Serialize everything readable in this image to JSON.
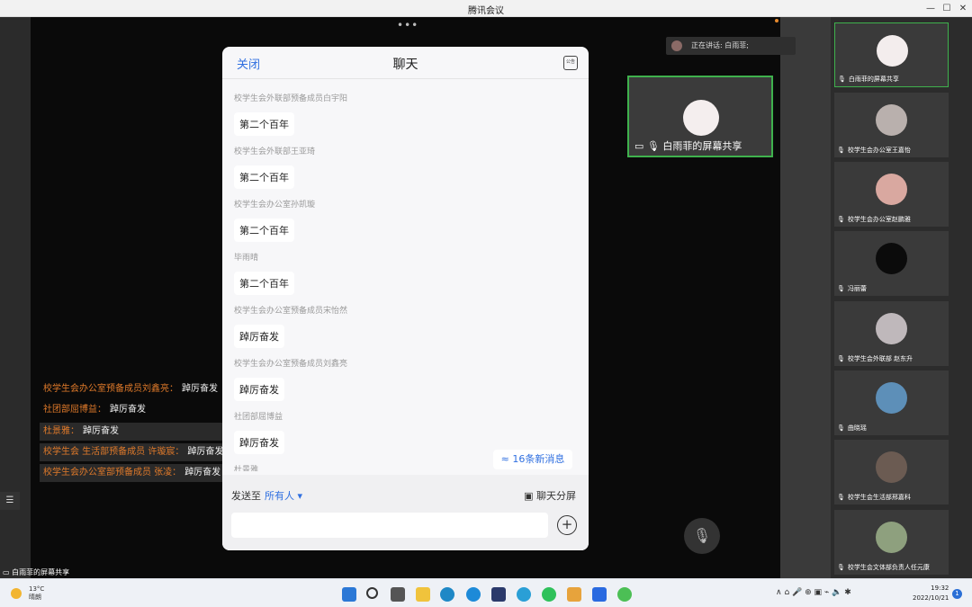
{
  "window": {
    "title": "腾讯会议",
    "minimize": "—",
    "maximize": "☐",
    "close": "✕"
  },
  "stage": {
    "dots": "•••",
    "speaking_text": "正在讲话: 白雨菲;",
    "share_caption": "白雨菲的屏幕共享",
    "bottom_share_caption": "白雨菲的屏幕共享",
    "mic_icon": "mic-icon",
    "list_icon": "☰"
  },
  "overlay_chat": [
    {
      "name": "校学生会办公室预备成员刘鑫亮：",
      "message": "踔厉奋发"
    },
    {
      "name": "社团部屈博益：",
      "message": "踔厉奋发"
    },
    {
      "name": "杜景雅：",
      "message": "踔厉奋发"
    },
    {
      "name": "校学生会 生活部预备成员 许璇宸：",
      "message": "踔厉奋发"
    },
    {
      "name": "校学生会办公室部预备成员 张凌：",
      "message": "踔厉奋发"
    }
  ],
  "participants": [
    {
      "name": "白雨菲的屏幕共享",
      "color": "#f3eded"
    },
    {
      "name": "校学生会办公室王嘉怡",
      "color": "#b9b0ad"
    },
    {
      "name": "校学生会办公室赵鹏雅",
      "color": "#d9a8a0"
    },
    {
      "name": "冯丽蕾",
      "color": "#0b0b0b"
    },
    {
      "name": "校学生会外联部 赵东升",
      "color": "#bfb8bb"
    },
    {
      "name": "曲晓瑶",
      "color": "#5d8fb8"
    },
    {
      "name": "校学生会生活部邢嘉科",
      "color": "#6b5b52"
    },
    {
      "name": "校学生会文体部负责人任元康",
      "color": "#8ea07e"
    }
  ],
  "chat": {
    "close_label": "关闭",
    "title": "聊天",
    "badge": "公告",
    "messages": [
      {
        "sender": "校学生会外联部预备成员白宇阳",
        "text": "第二个百年"
      },
      {
        "sender": "校学生会外联部王亚琦",
        "text": "第二个百年"
      },
      {
        "sender": "校学生会办公室孙凯璇",
        "text": "第二个百年"
      },
      {
        "sender": "毕雨晴",
        "text": "第二个百年"
      },
      {
        "sender": "校学生会办公室预备成员宋怡然",
        "text": "踔厉奋发"
      },
      {
        "sender": "校学生会办公室预备成员刘鑫亮",
        "text": "踔厉奋发"
      },
      {
        "sender": "社团部屈博益",
        "text": "踔厉奋发"
      },
      {
        "sender": "杜景雅",
        "text": ""
      }
    ],
    "new_messages": "≈ 16条新消息",
    "send_to_label": "发送至",
    "send_to_target": "所有人 ▾",
    "split_label": "聊天分屏",
    "input_placeholder": "",
    "plus": "+"
  },
  "taskbar": {
    "weather_temp": "13°C",
    "weather_desc": "晴朗",
    "time": "19:32",
    "date": "2022/10/21",
    "notif_count": "1",
    "tray_text": "∧   ⌂   🎤   ⊕   ▣   ⌁   🔈   ✱"
  }
}
